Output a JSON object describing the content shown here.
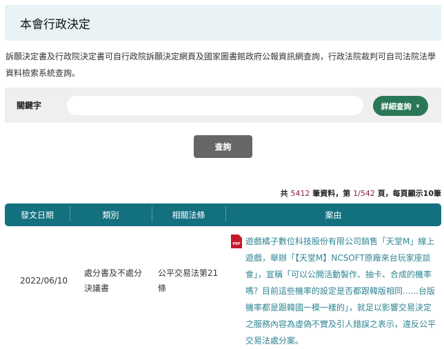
{
  "header": {
    "title": "本會行政決定"
  },
  "notice": "訴願決定書及行政院決定書可自行政院訴願決定網頁及國家圖書館政府公報資訊網查詢，行政法院裁判可自司法院法學資料檢索系統查詢。",
  "search": {
    "label": "關鍵字",
    "placeholder": "",
    "advanced_label": "詳細查詢",
    "submit_label": "查詢"
  },
  "results": {
    "prefix": "共",
    "total": "5412",
    "mid": "筆資料，第",
    "page": "1/542",
    "suffix": "頁，每頁顯示10筆"
  },
  "table": {
    "columns": [
      "發文日期",
      "類別",
      "相關法條",
      "案由"
    ],
    "rows": [
      {
        "date": "2022/06/10",
        "category": "處分書及不處分決議書",
        "law": "公平交易法第21條",
        "reason": "遊戲橘子數位科技股份有限公司銷售「天堂M」線上遊戲，舉辦「【天堂M】NCSOFT原廠來台玩家座談會」，宣稱「可以公開活動製作、抽卡、合成的機率嗎？目前這些機率的設定是否都跟韓版相同......台版機率都是跟韓國一模一樣的」，就足以影響交易決定之服務內容為虛偽不實及引人錯誤之表示，違反公平交易法處分案。",
        "icon": "pdf-icon",
        "icon_label": "PDF"
      }
    ]
  },
  "colors": {
    "header_bg": "#13707f",
    "advanced_bg": "#2a7757",
    "number": "#8a1d4a",
    "link": "#2f8593"
  }
}
